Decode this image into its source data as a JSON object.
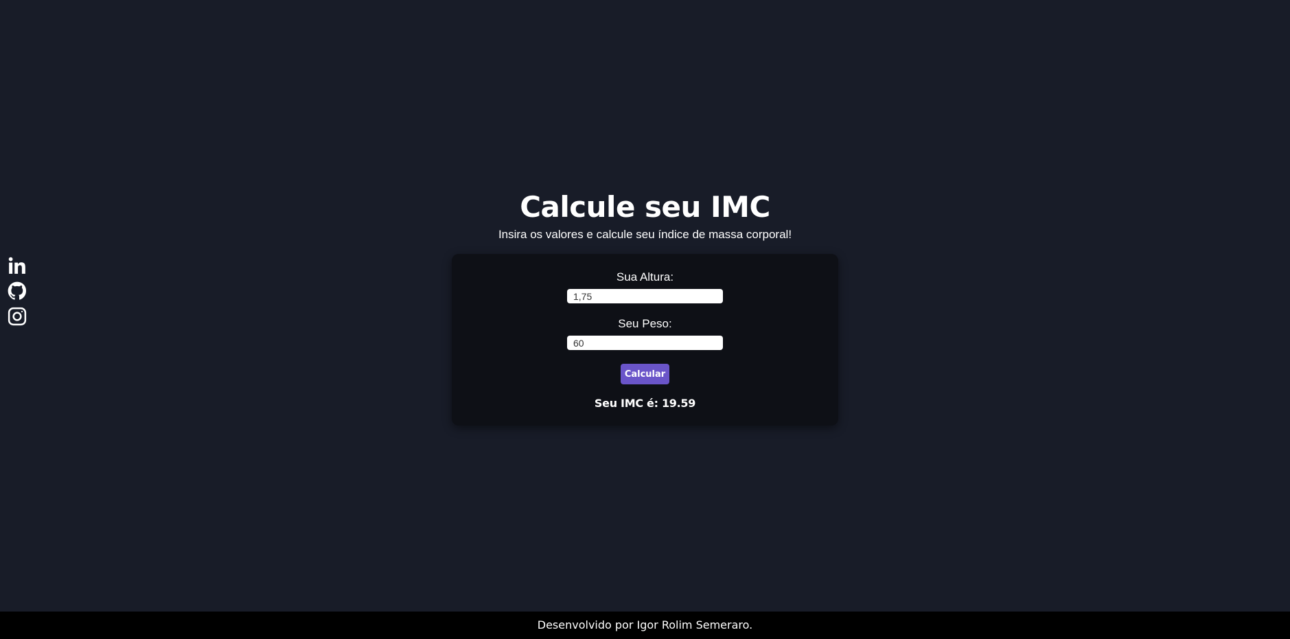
{
  "header": {
    "title": "Calcule seu IMC",
    "subtitle": "Insira os valores e calcule seu índice de massa corporal!"
  },
  "social": [
    {
      "icon": "linkedin-icon"
    },
    {
      "icon": "github-icon"
    },
    {
      "icon": "instagram-icon"
    }
  ],
  "form": {
    "height_label": "Sua Altura:",
    "height_value": "1,75",
    "weight_label": "Seu Peso:",
    "weight_value": "60",
    "button_label": "Calcular",
    "result_text": "Seu IMC é: 19.59"
  },
  "footer": {
    "text": "Desenvolvido por Igor Rolim Semeraro."
  },
  "colors": {
    "background": "#181c28",
    "card": "#0e1016",
    "button": "#6a55c9",
    "footer": "#000000"
  }
}
